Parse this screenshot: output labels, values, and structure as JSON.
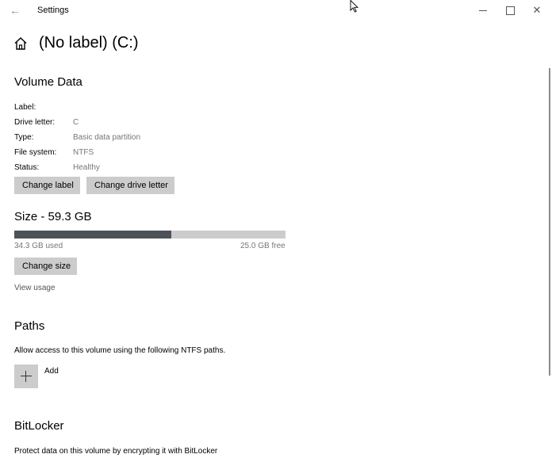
{
  "titlebar": {
    "app_title": "Settings",
    "back_glyph": "←",
    "close_glyph": "✕"
  },
  "page": {
    "title": "(No label) (C:)"
  },
  "volume_data": {
    "heading": "Volume Data",
    "rows": [
      {
        "label": "Label:",
        "value": ""
      },
      {
        "label": "Drive letter:",
        "value": "C"
      },
      {
        "label": "Type:",
        "value": "Basic data partition"
      },
      {
        "label": "File system:",
        "value": "NTFS"
      },
      {
        "label": "Status:",
        "value": "Healthy"
      }
    ],
    "change_label_button": "Change label",
    "change_drive_letter_button": "Change drive letter"
  },
  "size": {
    "heading": "Size - 59.3 GB",
    "used_text": "34.3 GB used",
    "free_text": "25.0 GB free",
    "used_fraction": 0.578,
    "change_size_button": "Change size",
    "view_usage_link": "View usage"
  },
  "paths": {
    "heading": "Paths",
    "description": "Allow access to this volume using the following NTFS paths.",
    "add_label": "Add"
  },
  "bitlocker": {
    "heading": "BitLocker",
    "description": "Protect data on this volume by encrypting it with BitLocker"
  },
  "icons": {
    "back": "back-arrow-icon",
    "home": "home-icon",
    "add": "plus-icon",
    "minimize": "minimize-icon",
    "maximize": "maximize-icon",
    "close": "close-icon"
  }
}
